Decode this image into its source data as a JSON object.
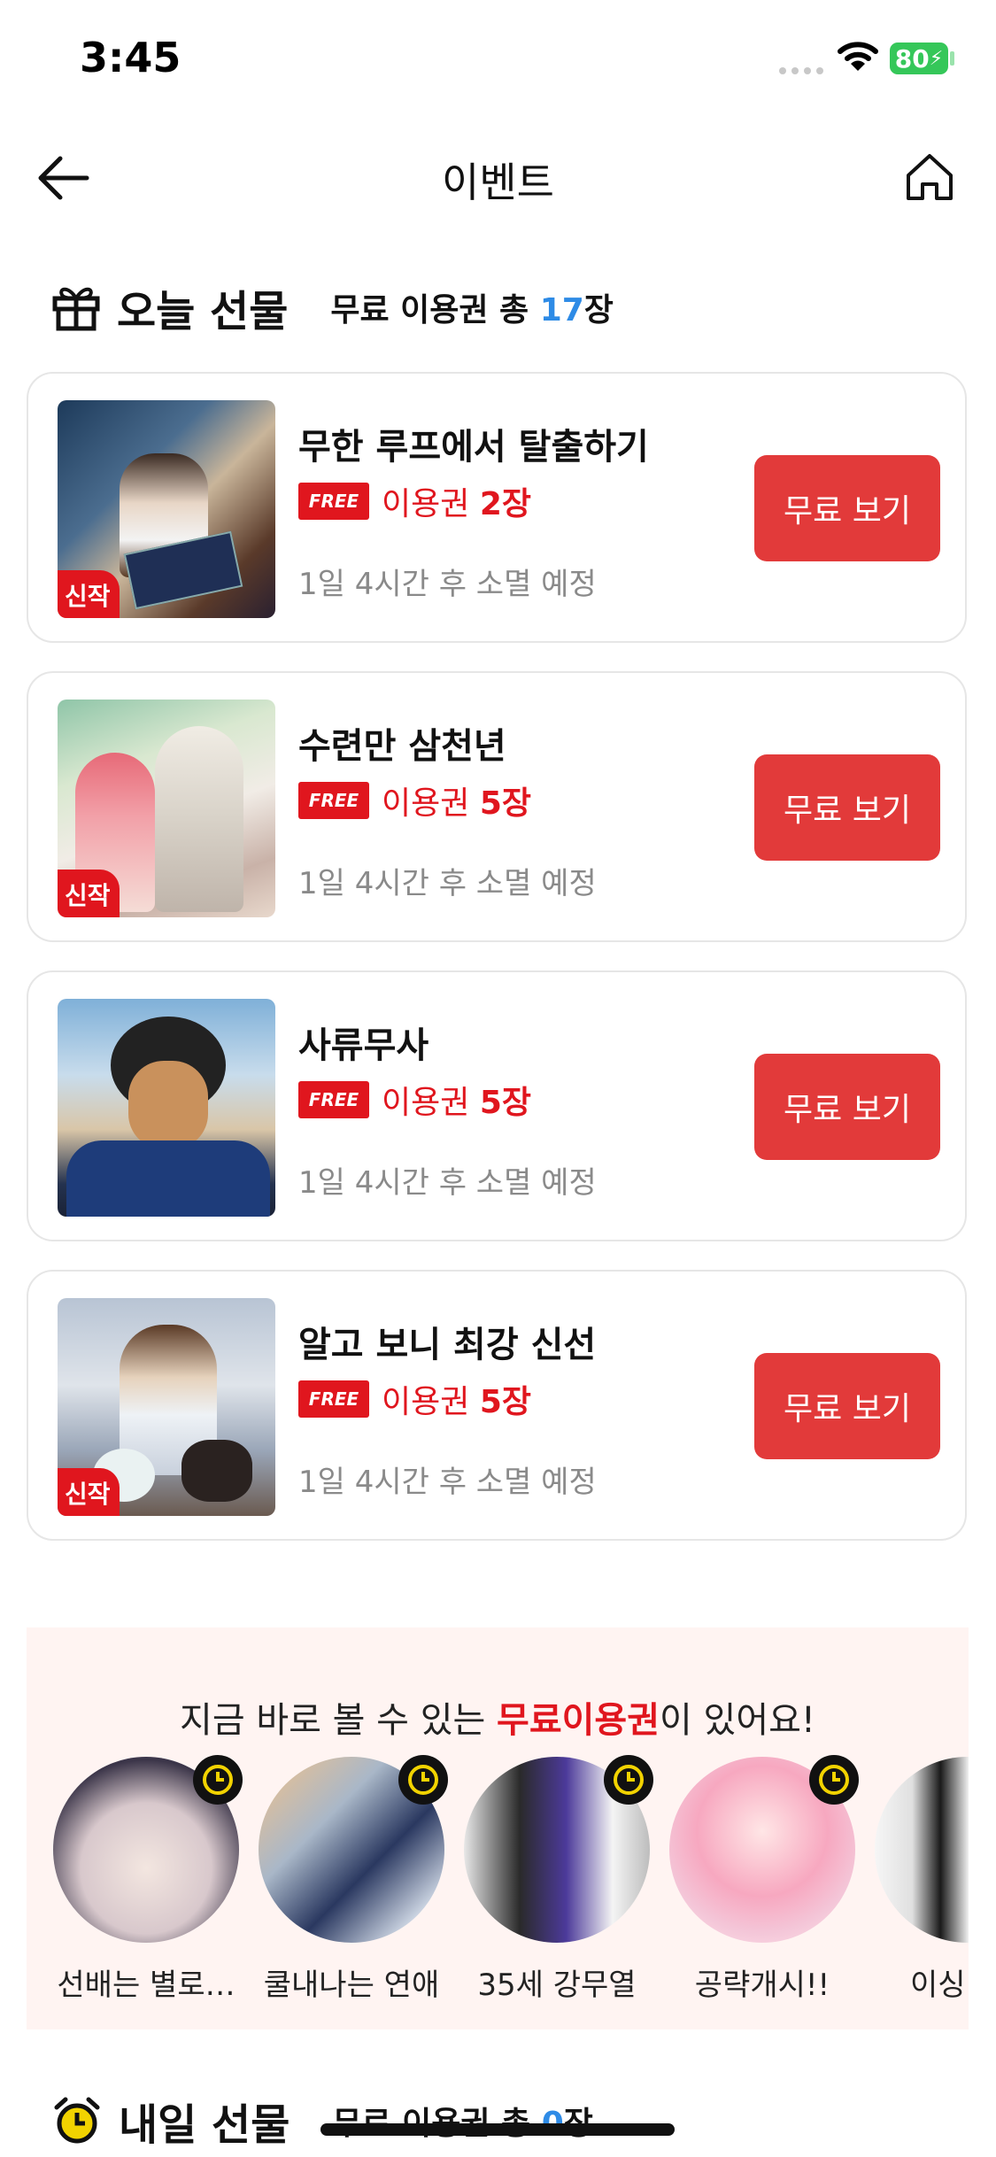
{
  "status": {
    "time": "3:45",
    "battery": "80"
  },
  "nav": {
    "title": "이벤트"
  },
  "today": {
    "title": "오늘 선물",
    "sub_prefix": "무료 이용권 총 ",
    "sub_count": "17",
    "sub_suffix": "장"
  },
  "ticket_prefix": "이용권 ",
  "free_tag": "FREE",
  "cards": [
    {
      "title": "무한 루프에서 탈출하기",
      "tickets": "2장",
      "expire": "1일 4시간 후 소멸 예정",
      "badge": "신작",
      "button": "무료 보기"
    },
    {
      "title": "수련만 삼천년",
      "tickets": "5장",
      "expire": "1일 4시간 후 소멸 예정",
      "badge": "신작",
      "button": "무료 보기"
    },
    {
      "title": "사류무사",
      "tickets": "5장",
      "expire": "1일 4시간 후 소멸 예정",
      "badge": "",
      "button": "무료 보기"
    },
    {
      "title": "알고 보니 최강 신선",
      "tickets": "5장",
      "expire": "1일 4시간 후 소멸 예정",
      "badge": "신작",
      "button": "무료 보기"
    }
  ],
  "promo": {
    "title_pre": "지금 바로 볼 수 있는 ",
    "title_hl": "무료이용권",
    "title_post": "이 있어요!",
    "items": [
      "선배는 별로…",
      "쿨내나는 연애",
      "35세 강무열",
      "공략개시!!",
      "이싱"
    ]
  },
  "tomorrow": {
    "title": "내일 선물",
    "sub_prefix": "무료 이용권 총 ",
    "sub_count": "0",
    "sub_suffix": "장"
  },
  "colors": {
    "accent": "#e0161e",
    "button": "#e23a3a",
    "count_blue": "#2e8be6"
  },
  "icons": [
    "back-arrow-icon",
    "home-icon",
    "gift-icon",
    "clock-icon",
    "alarm-clock-icon",
    "wifi-icon"
  ]
}
